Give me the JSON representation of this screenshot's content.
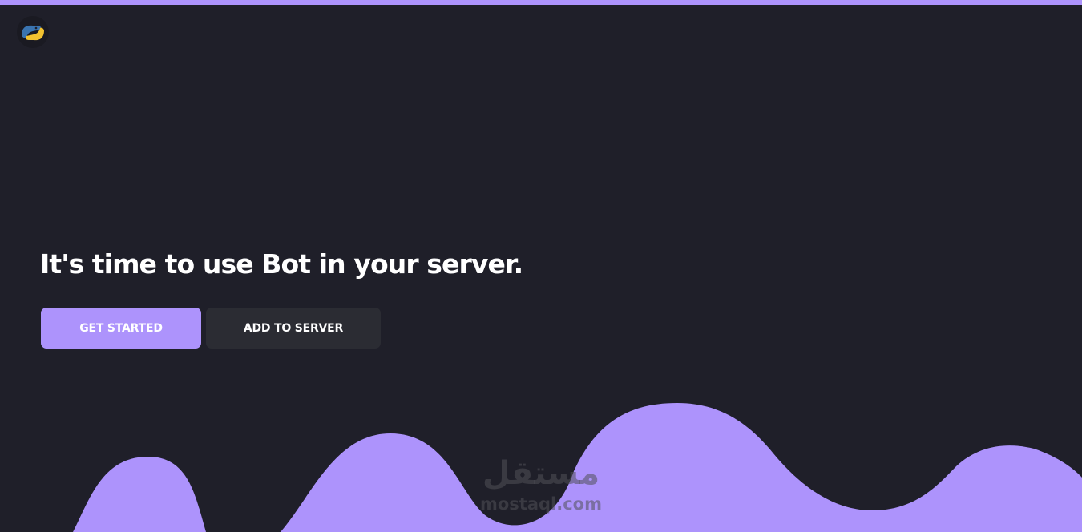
{
  "hero": {
    "title": "It's time to use Bot in your server."
  },
  "buttons": {
    "get_started": "GET STARTED",
    "add_to_server": "ADD TO SERVER"
  },
  "logo": {
    "icon": "python-logo-icon"
  },
  "watermark": {
    "arabic": "مستقل",
    "latin": "mostaql.com"
  },
  "colors": {
    "background": "#1f1f29",
    "accent": "#ad93fc",
    "secondary_button": "#2b2c33",
    "text": "#ffffff"
  }
}
